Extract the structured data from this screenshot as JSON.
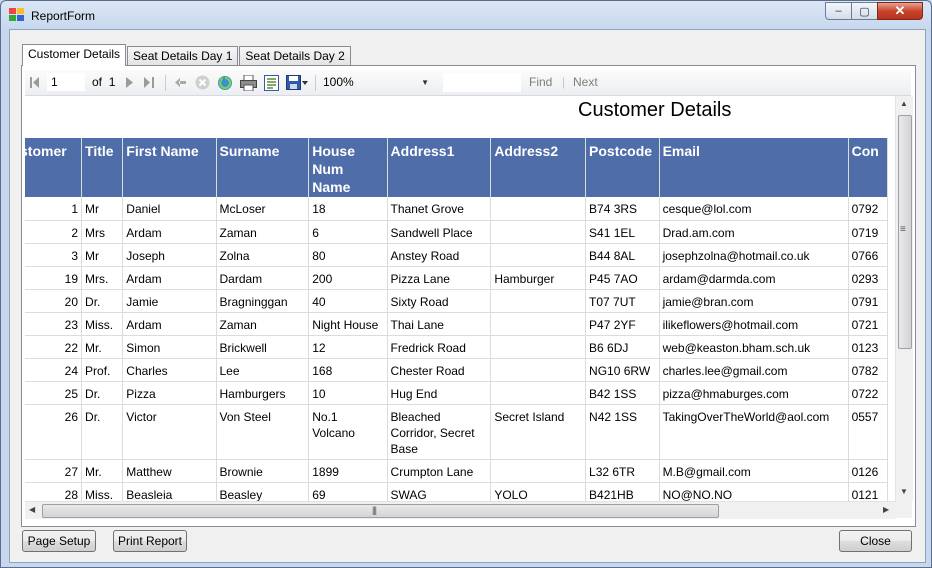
{
  "window": {
    "title": "ReportForm",
    "minimize_glyph": "‒",
    "maximize_glyph": "▢",
    "close_glyph": "✕"
  },
  "tabs": [
    {
      "label": "Customer Details"
    },
    {
      "label": "Seat Details Day 1"
    },
    {
      "label": "Seat Details Day 2"
    }
  ],
  "toolbar": {
    "page_current": "1",
    "page_of": "of",
    "page_total": "1",
    "zoom": "100%",
    "find_label": "Find",
    "separator": "|",
    "next_label": "Next",
    "icons": [
      "first-page-icon",
      "previous-page-icon",
      "next-page-icon",
      "last-page-icon",
      "back-icon",
      "stop-icon",
      "refresh-icon",
      "print-icon",
      "print-layout-icon",
      "export-icon"
    ]
  },
  "report": {
    "title": "Customer Details",
    "headers": [
      "stomer",
      "Title",
      "First Name",
      "Surname",
      "House Num Name",
      "Address1",
      "Address2",
      "Postcode",
      "Email",
      "Con"
    ],
    "rows": [
      [
        "1",
        "Mr",
        "Daniel",
        "McLoser",
        "18",
        "Thanet Grove",
        "",
        "B74 3RS",
        "cesque@lol.com",
        "0792"
      ],
      [
        "2",
        "Mrs",
        "Ardam",
        "Zaman",
        "6",
        "Sandwell Place",
        "",
        "S41 1EL",
        "Drad.am.com",
        "0719"
      ],
      [
        "3",
        "Mr",
        "Joseph",
        "Zolna",
        "80",
        "Anstey Road",
        "",
        "B44 8AL",
        "josephzolna@hotmail.co.uk",
        "0766"
      ],
      [
        "19",
        "Mrs.",
        "Ardam",
        "Dardam",
        "200",
        "Pizza Lane",
        "Hamburger",
        "P45 7AO",
        "ardam@darmda.com",
        "0293"
      ],
      [
        "20",
        "Dr.",
        "Jamie",
        "Bragninggan",
        "40",
        "Sixty Road",
        "",
        "T07 7UT",
        "jamie@bran.com",
        "0791"
      ],
      [
        "23",
        "Miss.",
        "Ardam",
        "Zaman",
        "Night House",
        "Thai Lane",
        "",
        "P47 2YF",
        "ilikeflowers@hotmail.com",
        "0721"
      ],
      [
        "22",
        "Mr.",
        "Simon",
        "Brickwell",
        "12",
        "Fredrick Road",
        "",
        "B6 6DJ",
        "web@keaston.bham.sch.uk",
        "0123"
      ],
      [
        "24",
        "Prof.",
        "Charles",
        "Lee",
        "168",
        "Chester Road",
        "",
        "NG10 6RW",
        "charles.lee@gmail.com",
        "0782"
      ],
      [
        "25",
        "Dr.",
        "Pizza",
        "Hamburgers",
        "10",
        "Hug End",
        "",
        "B42 1SS",
        "pizza@hmaburges.com",
        "0722"
      ],
      [
        "26",
        "Dr.",
        "Victor",
        "Von Steel",
        "No.1 Volcano",
        "Bleached Corridor, Secret Base",
        "Secret Island",
        "N42 1SS",
        "TakingOverTheWorld@aol.com",
        "0557"
      ],
      [
        "27",
        "Mr.",
        "Matthew",
        "Brownie",
        "1899",
        "Crumpton Lane",
        "",
        "L32 6TR",
        "M.B@gmail.com",
        "0126"
      ],
      [
        "28",
        "Miss.",
        "Beasleia",
        "Beasley",
        "69",
        "SWAG",
        "YOLO",
        "B421HB",
        "NO@NO.NO",
        "0121"
      ]
    ]
  },
  "scroll": {
    "grip": "|||",
    "up": "▲",
    "down": "▼",
    "left": "◀",
    "right": "▶",
    "side_grip": "≡"
  },
  "buttons": {
    "page_setup": "Page Setup",
    "print_report": "Print Report",
    "close": "Close"
  }
}
